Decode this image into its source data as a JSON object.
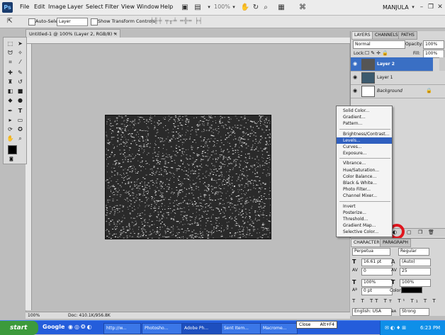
{
  "menubar": {
    "logo": "Ps",
    "items": [
      "File",
      "Edit",
      "Image",
      "Layer",
      "Select",
      "Filter",
      "View",
      "Window",
      "Help"
    ],
    "zoom": "100%",
    "workspace": "MANJULA"
  },
  "options": {
    "auto_select_label": "Auto-Select:",
    "auto_select_value": "Layer",
    "show_transform_label": "Show Transform Controls"
  },
  "document": {
    "tab_title": "Untitled-1 @ 100% (Layer 2, RGB/8) *",
    "status_zoom": "100%",
    "status_doc": "Doc: 410.1K/956.8K"
  },
  "layers_panel": {
    "tabs": [
      "LAYERS",
      "CHANNELS",
      "PATHS"
    ],
    "blend_mode": "Normal",
    "opacity_label": "Opacity:",
    "opacity_value": "100%",
    "lock_label": "Lock:",
    "fill_label": "Fill:",
    "fill_value": "100%",
    "layers": [
      {
        "name": "Layer 2",
        "selected": true
      },
      {
        "name": "Layer 1",
        "selected": false
      },
      {
        "name": "Background",
        "selected": false
      }
    ]
  },
  "adjust_menu": {
    "groups": [
      [
        "Solid Color...",
        "Gradient...",
        "Pattern..."
      ],
      [
        "Brightness/Contrast...",
        "Levels...",
        "Curves...",
        "Exposure..."
      ],
      [
        "Vibrance...",
        "Hue/Saturation...",
        "Color Balance...",
        "Black & White...",
        "Photo Filter...",
        "Channel Mixer..."
      ],
      [
        "Invert",
        "Posterize...",
        "Threshold...",
        "Gradient Map...",
        "Selective Color..."
      ]
    ],
    "highlighted": "Levels..."
  },
  "character_panel": {
    "tabs": [
      "CHARACTER",
      "PARAGRAPH"
    ],
    "font_family": "Perpetua",
    "font_style": "Regular",
    "font_size": "16.61 pt",
    "leading": "(Auto)",
    "kerning": "0",
    "tracking": "25",
    "vscale": "100%",
    "hscale": "100%",
    "baseline": "0 pt",
    "color_label": "Color:",
    "language": "English: USA",
    "antialias": "Strong",
    "aa_label": "aᴀ"
  },
  "taskbar": {
    "start": "start",
    "google": "Google",
    "tasks": [
      "http://w...",
      "Photosho...",
      "Adobe Ph...",
      "Sent Item...",
      "Macrome..."
    ],
    "close_label": "Close",
    "close_key": "Alt+F4",
    "clock": "6:23 PM"
  },
  "colors": {
    "accent": "#2f5fbf",
    "red_circle": "#e0151d",
    "taskbar": "#245ddb"
  }
}
